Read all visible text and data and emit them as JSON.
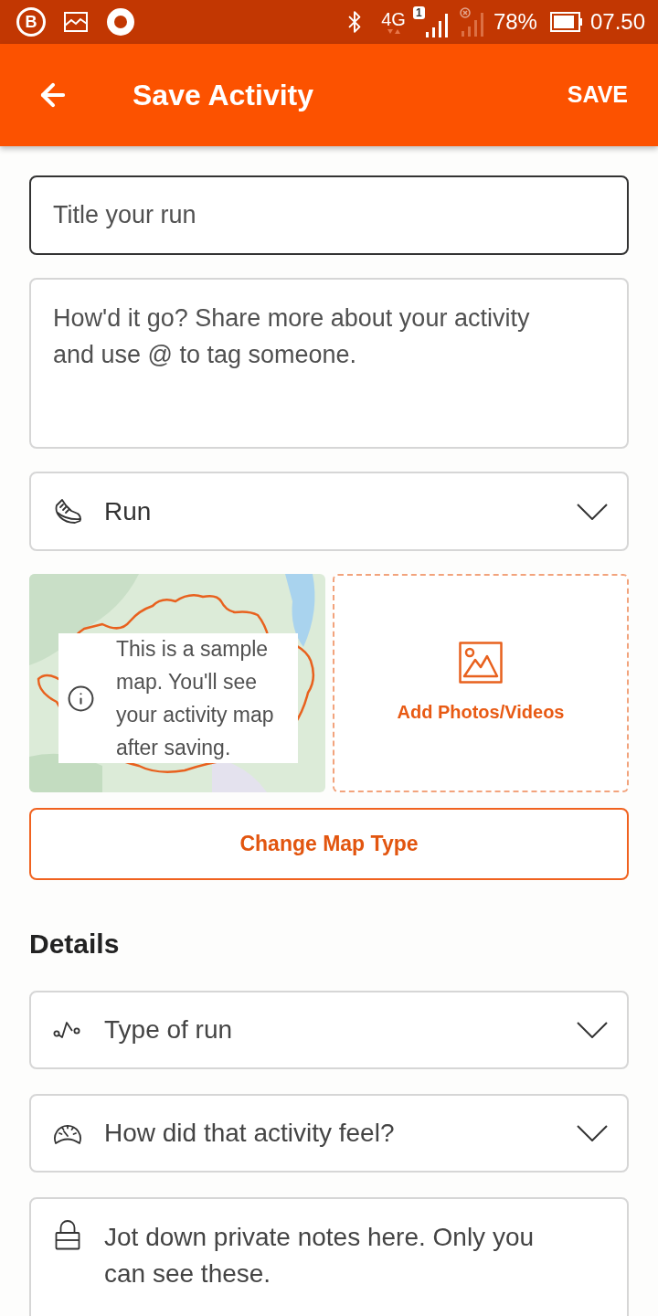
{
  "status_bar": {
    "notification_letter": "B",
    "network": "4G",
    "sim_number": "1",
    "battery": "78%",
    "time": "07.50"
  },
  "app_bar": {
    "title": "Save Activity",
    "action": "SAVE"
  },
  "title_field": {
    "placeholder": "Title your run",
    "focused": true
  },
  "description_field": {
    "placeholder": "How'd it go? Share more about your activity and use @ to tag someone."
  },
  "sport_select": {
    "value": "Run"
  },
  "map_preview": {
    "notice": "This is a sample map. You'll see your activity map after saving."
  },
  "add_media_button": {
    "label": "Add Photos/Videos"
  },
  "change_map_type_button": {
    "label": "Change Map Type"
  },
  "details": {
    "heading": "Details",
    "fields": [
      {
        "kind": "select",
        "label": "Type of run"
      },
      {
        "kind": "select",
        "label": "How did that activity feel?"
      },
      {
        "kind": "notes",
        "placeholder": "Jot down private notes here. Only you can see these."
      }
    ]
  }
}
